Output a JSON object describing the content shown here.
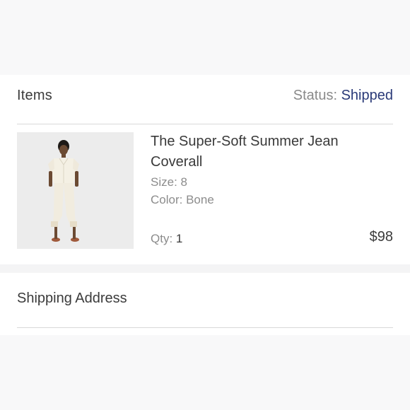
{
  "items": {
    "title": "Items",
    "status_label": "Status:",
    "status_value": "Shipped",
    "product": {
      "name": "The Super-Soft Summer Jean Coverall",
      "size": "Size: 8",
      "color": "Color: Bone",
      "qty_label": "Qty:",
      "qty_value": "1",
      "price": "$98",
      "image_icon": "model-coverall-photo"
    }
  },
  "shipping": {
    "title": "Shipping Address"
  },
  "colors": {
    "status_accent": "#2a3a78",
    "text": "#3a3a3a",
    "muted": "#8c8c8c"
  }
}
